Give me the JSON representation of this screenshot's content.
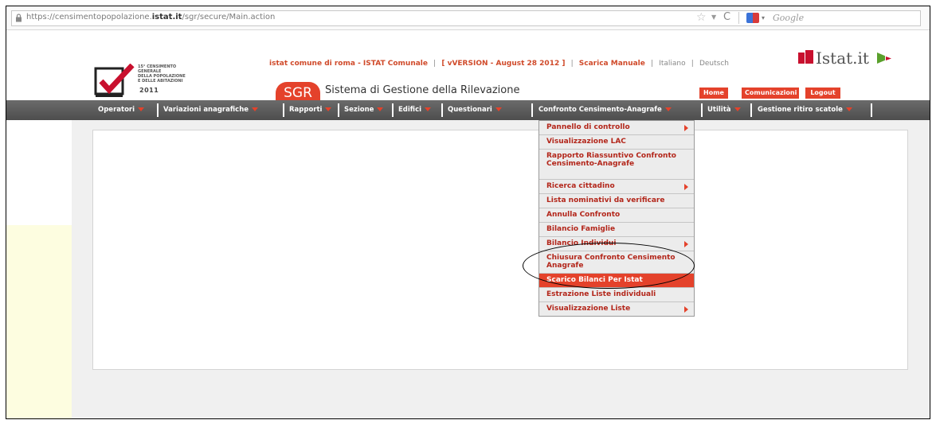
{
  "browser": {
    "url_prefix": "https://censimentopopolazione.",
    "url_domain": "istat.it",
    "url_suffix": "/sgr/secure/Main.action",
    "search_placeholder": "Google"
  },
  "header": {
    "logo_text_1": "15° CENSIMENTO GENERALE",
    "logo_text_2": "DELLA POPOLAZIONE",
    "logo_text_3": "E DELLE ABITAZIONI",
    "logo_year": "2011",
    "user_info": "istat comune di roma - ISTAT Comunale",
    "version": "[ vVERSION - August 28 2012 ]",
    "manual": "Scarica Manuale",
    "lang_it": "Italiano",
    "lang_de": "Deutsch",
    "sep": "|",
    "istat_brand": "Istat.it",
    "app_badge": "SGR",
    "app_title": "Sistema di Gestione della Rilevazione",
    "btn_home": "Home",
    "btn_comunicazioni": "Comunicazioni",
    "btn_logout": "Logout"
  },
  "nav": [
    "Operatori",
    "Variazioni anagrafiche",
    "Rapporti",
    "Sezione",
    "Edifici",
    "Questionari",
    "Confronto Censimento-Anagrafe",
    "Utilità",
    "Gestione ritiro scatole"
  ],
  "menu": [
    {
      "label": "Pannello di controllo",
      "submenu": true
    },
    {
      "label": "Visualizzazione LAC",
      "submenu": false
    },
    {
      "label": "Rapporto Riassuntivo Confronto Censimento-Anagrafe",
      "submenu": false
    },
    {
      "label": "Ricerca cittadino",
      "submenu": true
    },
    {
      "label": "Lista nominativi da verificare",
      "submenu": false
    },
    {
      "label": "Annulla Confronto",
      "submenu": false
    },
    {
      "label": "Bilancio Famiglie",
      "submenu": false
    },
    {
      "label": "Bilancio Individui",
      "submenu": true
    },
    {
      "label": "Chiusura Confronto Censimento Anagrafe",
      "submenu": false
    },
    {
      "label": "Scarico Bilanci Per Istat",
      "submenu": false,
      "selected": true
    },
    {
      "label": "Estrazione Liste individuali",
      "submenu": false
    },
    {
      "label": "Visualizzazione Liste",
      "submenu": true
    }
  ],
  "colors": {
    "accent": "#e4422b",
    "menu_text": "#b3261a",
    "nav_bg": "#5a5a5a"
  }
}
